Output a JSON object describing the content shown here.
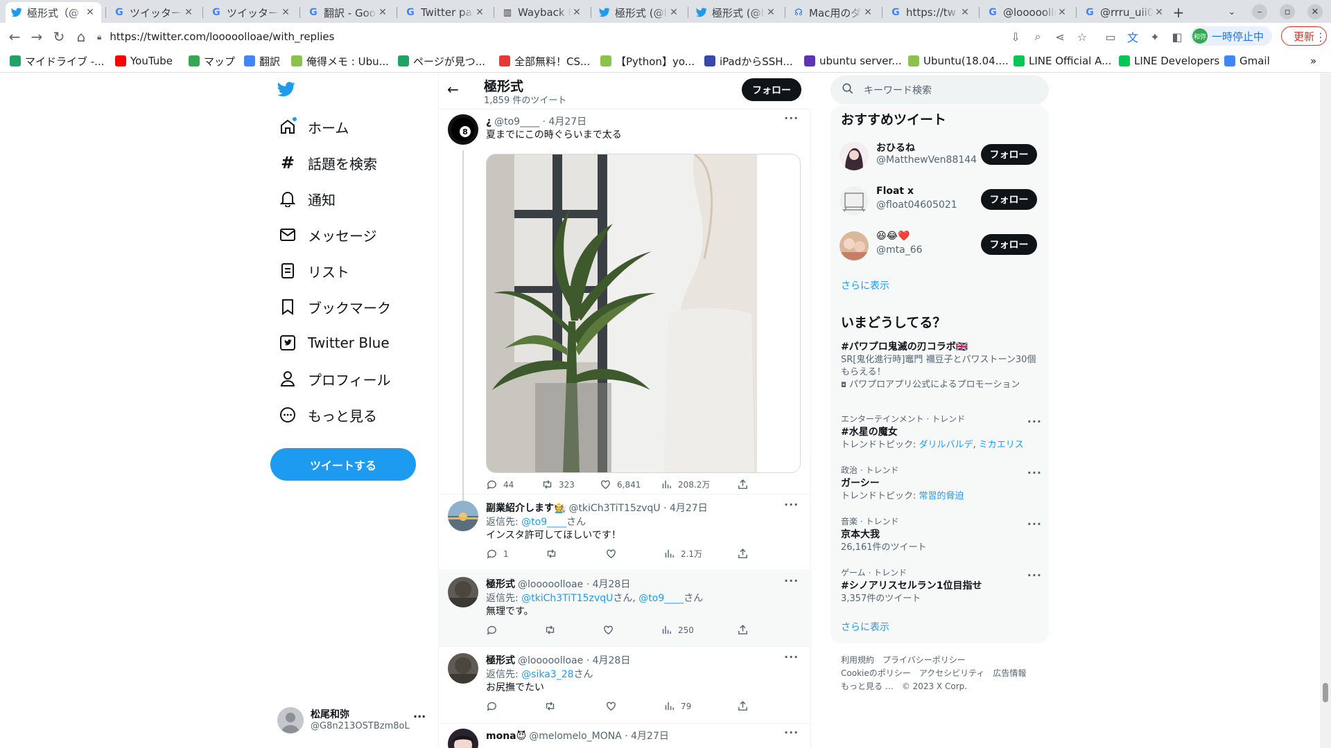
{
  "browser": {
    "tabs": [
      {
        "title": "極形式（@",
        "icon": "twitter-icon",
        "active": true
      },
      {
        "title": "ツイッター",
        "icon": "google-icon",
        "active": false
      },
      {
        "title": "ツイッター",
        "icon": "google-icon",
        "active": false
      },
      {
        "title": "翻訳 - Goo",
        "icon": "google-icon",
        "active": false
      },
      {
        "title": "Twitter pas",
        "icon": "google-icon",
        "active": false
      },
      {
        "title": "Wayback M",
        "icon": "wayback-icon",
        "active": false
      },
      {
        "title": "極形式 (@l",
        "icon": "twitter-icon",
        "active": false
      },
      {
        "title": "極形式 (@l",
        "icon": "twitter-icon",
        "active": false
      },
      {
        "title": "Mac用のダ",
        "icon": "headset-icon",
        "active": false
      },
      {
        "title": "https://tw",
        "icon": "google-icon",
        "active": false
      },
      {
        "title": "@looooolloa",
        "icon": "google-icon",
        "active": false
      },
      {
        "title": "@rrru_uii0",
        "icon": "google-icon",
        "active": false
      }
    ],
    "new_tab": "+",
    "url": "https://twitter.com/looooolloae/with_replies",
    "profile_pill": {
      "avatar_text": "和弥",
      "label": "一時停止中"
    },
    "update_label": "更新",
    "bookmarks": [
      {
        "label": "マイドライブ -...",
        "icon": "drive-icon",
        "color": "#1fa463"
      },
      {
        "label": "YouTube",
        "icon": "youtube-icon",
        "color": "#ff0000"
      },
      {
        "label": "マップ",
        "icon": "maps-icon",
        "color": "#34a853"
      },
      {
        "label": "翻訳",
        "icon": "translate-icon",
        "color": "#4285f4"
      },
      {
        "label": "俺得メモ : Ubu...",
        "icon": "site-icon",
        "color": "#8bc34a"
      },
      {
        "label": "ページが見つ...",
        "icon": "drive-icon",
        "color": "#1fa463"
      },
      {
        "label": "全部無料！CS...",
        "icon": "site-icon",
        "color": "#e53935"
      },
      {
        "label": "【Python】yo...",
        "icon": "site-icon",
        "color": "#8bc34a"
      },
      {
        "label": "iPadからSSH...",
        "icon": "site-icon",
        "color": "#3949ab"
      },
      {
        "label": "ubuntu server...",
        "icon": "site-icon",
        "color": "#5e35b1"
      },
      {
        "label": "Ubuntu(18.04....",
        "icon": "site-icon",
        "color": "#8bc34a"
      },
      {
        "label": "LINE Official A...",
        "icon": "line-icon",
        "color": "#06c755"
      },
      {
        "label": "LINE Developers",
        "icon": "line-icon",
        "color": "#06c755"
      },
      {
        "label": "Gmail",
        "icon": "google-icon",
        "color": "#4285f4"
      }
    ]
  },
  "nav": {
    "items": [
      {
        "label": "ホーム",
        "icon": "home-icon"
      },
      {
        "label": "話題を検索",
        "icon": "hashtag-icon"
      },
      {
        "label": "通知",
        "icon": "bell-icon"
      },
      {
        "label": "メッセージ",
        "icon": "envelope-icon"
      },
      {
        "label": "リスト",
        "icon": "list-icon"
      },
      {
        "label": "ブックマーク",
        "icon": "bookmark-icon"
      },
      {
        "label": "Twitter Blue",
        "icon": "twitter-blue-icon"
      },
      {
        "label": "プロフィール",
        "icon": "person-icon"
      },
      {
        "label": "もっと見る",
        "icon": "more-circle-icon"
      }
    ],
    "tweet_button": "ツイートする",
    "account": {
      "name": "松尾和弥",
      "handle": "@G8n213OSTBzm8oL"
    }
  },
  "header": {
    "title": "極形式",
    "count": "1,859 件のツイート",
    "follow": "フォロー"
  },
  "tweets": [
    {
      "name": "¿",
      "handle": "@to9____",
      "date": "· 4月27日",
      "reply_prefix": "",
      "reply_to": [],
      "reply_suffix": "",
      "text": "夏までにこの時ぐらいまで太る",
      "replies": "44",
      "retweets": "323",
      "likes": "6,841",
      "views": "208.2万"
    },
    {
      "name": "副業紹介します🧑‍🌾",
      "handle": "@tkiCh3TiT15zvqU",
      "date": "· 4月27日",
      "reply_prefix": "返信先: ",
      "reply_to": [
        "@to9____"
      ],
      "reply_suffix": "さん",
      "text": "インスタ許可してほしいです！",
      "replies": "1",
      "retweets": "",
      "likes": "",
      "views": "2.1万"
    },
    {
      "name": "極形式",
      "handle": "@looooolloae",
      "date": "· 4月28日",
      "reply_prefix": "返信先: ",
      "reply_to": [
        "@tkiCh3TiT15zvqU",
        "@to9____"
      ],
      "reply_mid": "さん, ",
      "reply_suffix": "さん",
      "text": "無理です。",
      "replies": "",
      "retweets": "",
      "likes": "",
      "views": "250"
    },
    {
      "name": "極形式",
      "handle": "@looooolloae",
      "date": "· 4月28日",
      "reply_prefix": "返信先: ",
      "reply_to": [
        "@sika3_28"
      ],
      "reply_suffix": "さん",
      "text": "お尻撫でたい",
      "replies": "",
      "retweets": "",
      "likes": "",
      "views": "79"
    },
    {
      "name": "mona😈",
      "handle": "@melomelo_MONA",
      "date": "· 4月27日",
      "reply_prefix": "",
      "reply_to": [],
      "reply_suffix": "",
      "text": "",
      "replies": "",
      "retweets": "",
      "likes": "",
      "views": ""
    }
  ],
  "search": {
    "placeholder": "キーワード検索"
  },
  "recommended": {
    "title": "おすすめツイート",
    "users": [
      {
        "name": "おひるね",
        "handle": "@MatthewVen88144",
        "button": "フォロー"
      },
      {
        "name": "Float x",
        "handle": "@float04605021",
        "button": "フォロー"
      },
      {
        "name": "😆😂❤️",
        "handle": "@mta_66",
        "button": "フォロー"
      }
    ],
    "show_more": "さらに表示"
  },
  "trends": {
    "title": "いまどうしてる？",
    "promoted": {
      "name": "#パワプロ鬼滅の刃コラボ🇬🇧",
      "desc": "SR[鬼化進行時]竈門 禰豆子とパワストーン30個もらえる！",
      "promoted_by": "パワプロアプリ公式によるプロモーション"
    },
    "items": [
      {
        "context": "エンターテインメント · トレンド",
        "name": "#水星の魔女",
        "desc_prefix": "トレンドトピック: ",
        "links": [
          "ダリルバルデ",
          "ミカエリス"
        ],
        "desc": ""
      },
      {
        "context": "政治 · トレンド",
        "name": "ガーシー",
        "desc_prefix": "トレンドトピック: ",
        "links": [
          "常習的脅迫"
        ],
        "desc": ""
      },
      {
        "context": "音楽 · トレンド",
        "name": "京本大我",
        "desc_prefix": "",
        "links": [],
        "desc": "26,161件のツイート"
      },
      {
        "context": "ゲーム · トレンド",
        "name": "#シノアリスセルラン1位目指せ",
        "desc_prefix": "",
        "links": [],
        "desc": "3,357件のツイート"
      }
    ],
    "show_more": "さらに表示"
  },
  "footer": {
    "links": [
      "利用規約",
      "プライバシーポリシー",
      "Cookieのポリシー",
      "アクセシビリティ",
      "広告情報",
      "もっと見る …",
      "© 2023 X Corp."
    ]
  }
}
